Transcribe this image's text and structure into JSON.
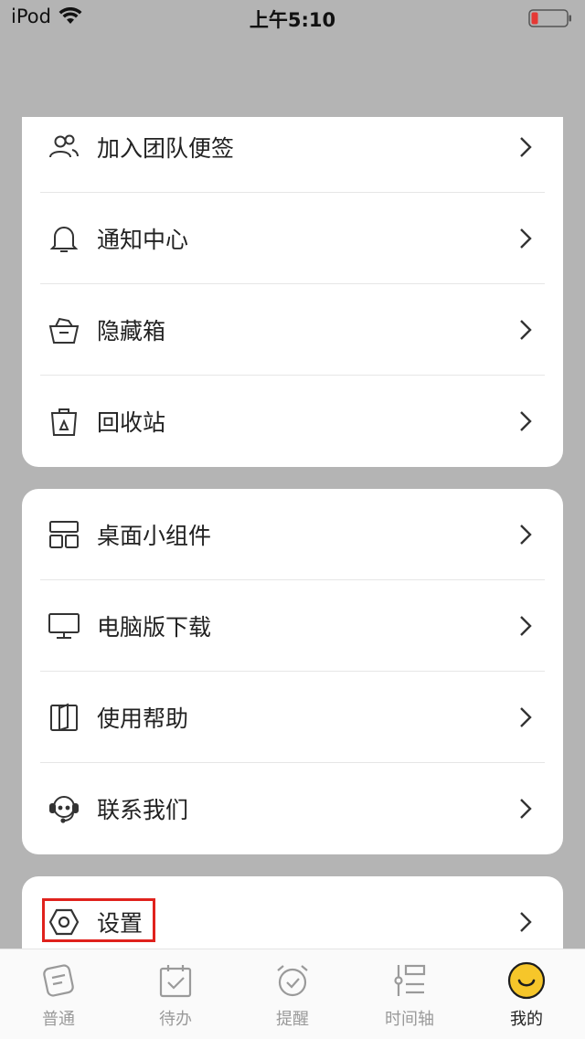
{
  "status_bar": {
    "device": "iPod",
    "time": "上午5:10"
  },
  "group1": [
    {
      "label": "加入团队便签",
      "icon": "team-icon"
    },
    {
      "label": "通知中心",
      "icon": "bell-icon"
    },
    {
      "label": "隐藏箱",
      "icon": "hidden-box-icon"
    },
    {
      "label": "回收站",
      "icon": "recycle-bin-icon"
    }
  ],
  "group2": [
    {
      "label": "桌面小组件",
      "icon": "widget-icon"
    },
    {
      "label": "电脑版下载",
      "icon": "monitor-icon"
    },
    {
      "label": "使用帮助",
      "icon": "book-icon"
    },
    {
      "label": "联系我们",
      "icon": "headset-icon"
    }
  ],
  "group3": [
    {
      "label": "设置",
      "icon": "settings-icon"
    }
  ],
  "tabbar": [
    {
      "label": "普通",
      "icon": "note-icon"
    },
    {
      "label": "待办",
      "icon": "todo-calendar-icon"
    },
    {
      "label": "提醒",
      "icon": "alarm-clock-icon"
    },
    {
      "label": "时间轴",
      "icon": "timeline-icon"
    },
    {
      "label": "我的",
      "icon": "smiley-avatar-icon"
    }
  ],
  "colors": {
    "accent": "#f6c62a",
    "highlight": "#e0221d",
    "background": "#b4b4b4"
  }
}
